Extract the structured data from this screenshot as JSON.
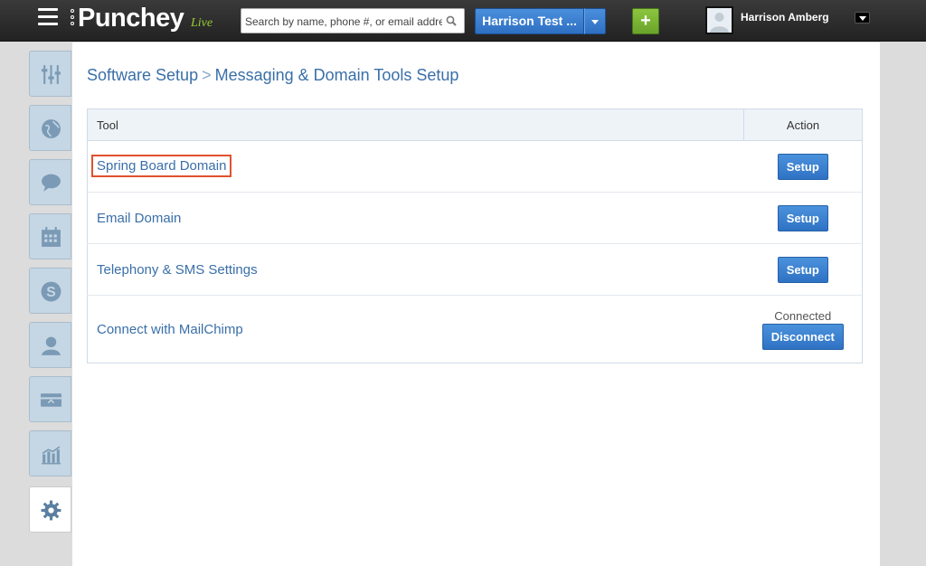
{
  "header": {
    "brand": "Punchey",
    "brand_tag": "Live",
    "search_placeholder": "Search by name, phone #, or email address",
    "account_label": "Harrison Test ...",
    "add_label": "+",
    "user_name": "Harrison Amberg"
  },
  "sidebar": {
    "items": [
      {
        "icon": "sliders-icon"
      },
      {
        "icon": "globe-icon"
      },
      {
        "icon": "chat-bubble-icon"
      },
      {
        "icon": "calendar-icon"
      },
      {
        "icon": "dollar-icon"
      },
      {
        "icon": "person-icon"
      },
      {
        "icon": "card-icon"
      },
      {
        "icon": "bar-chart-icon"
      },
      {
        "icon": "gear-icon",
        "active": true
      }
    ]
  },
  "breadcrumb": {
    "parent": "Software Setup",
    "separator": ">",
    "current": "Messaging & Domain Tools Setup"
  },
  "table": {
    "headers": {
      "tool": "Tool",
      "action": "Action"
    },
    "rows": [
      {
        "tool": "Spring Board Domain",
        "action": "Setup",
        "highlighted": true
      },
      {
        "tool": "Email Domain",
        "action": "Setup"
      },
      {
        "tool": "Telephony & SMS Settings",
        "action": "Setup"
      },
      {
        "tool": "Connect with MailChimp",
        "status": "Connected",
        "action": "Disconnect"
      }
    ]
  },
  "colors": {
    "accent_blue": "#2f72c4",
    "add_green": "#6aa32a",
    "highlight_red": "#e0522e"
  }
}
